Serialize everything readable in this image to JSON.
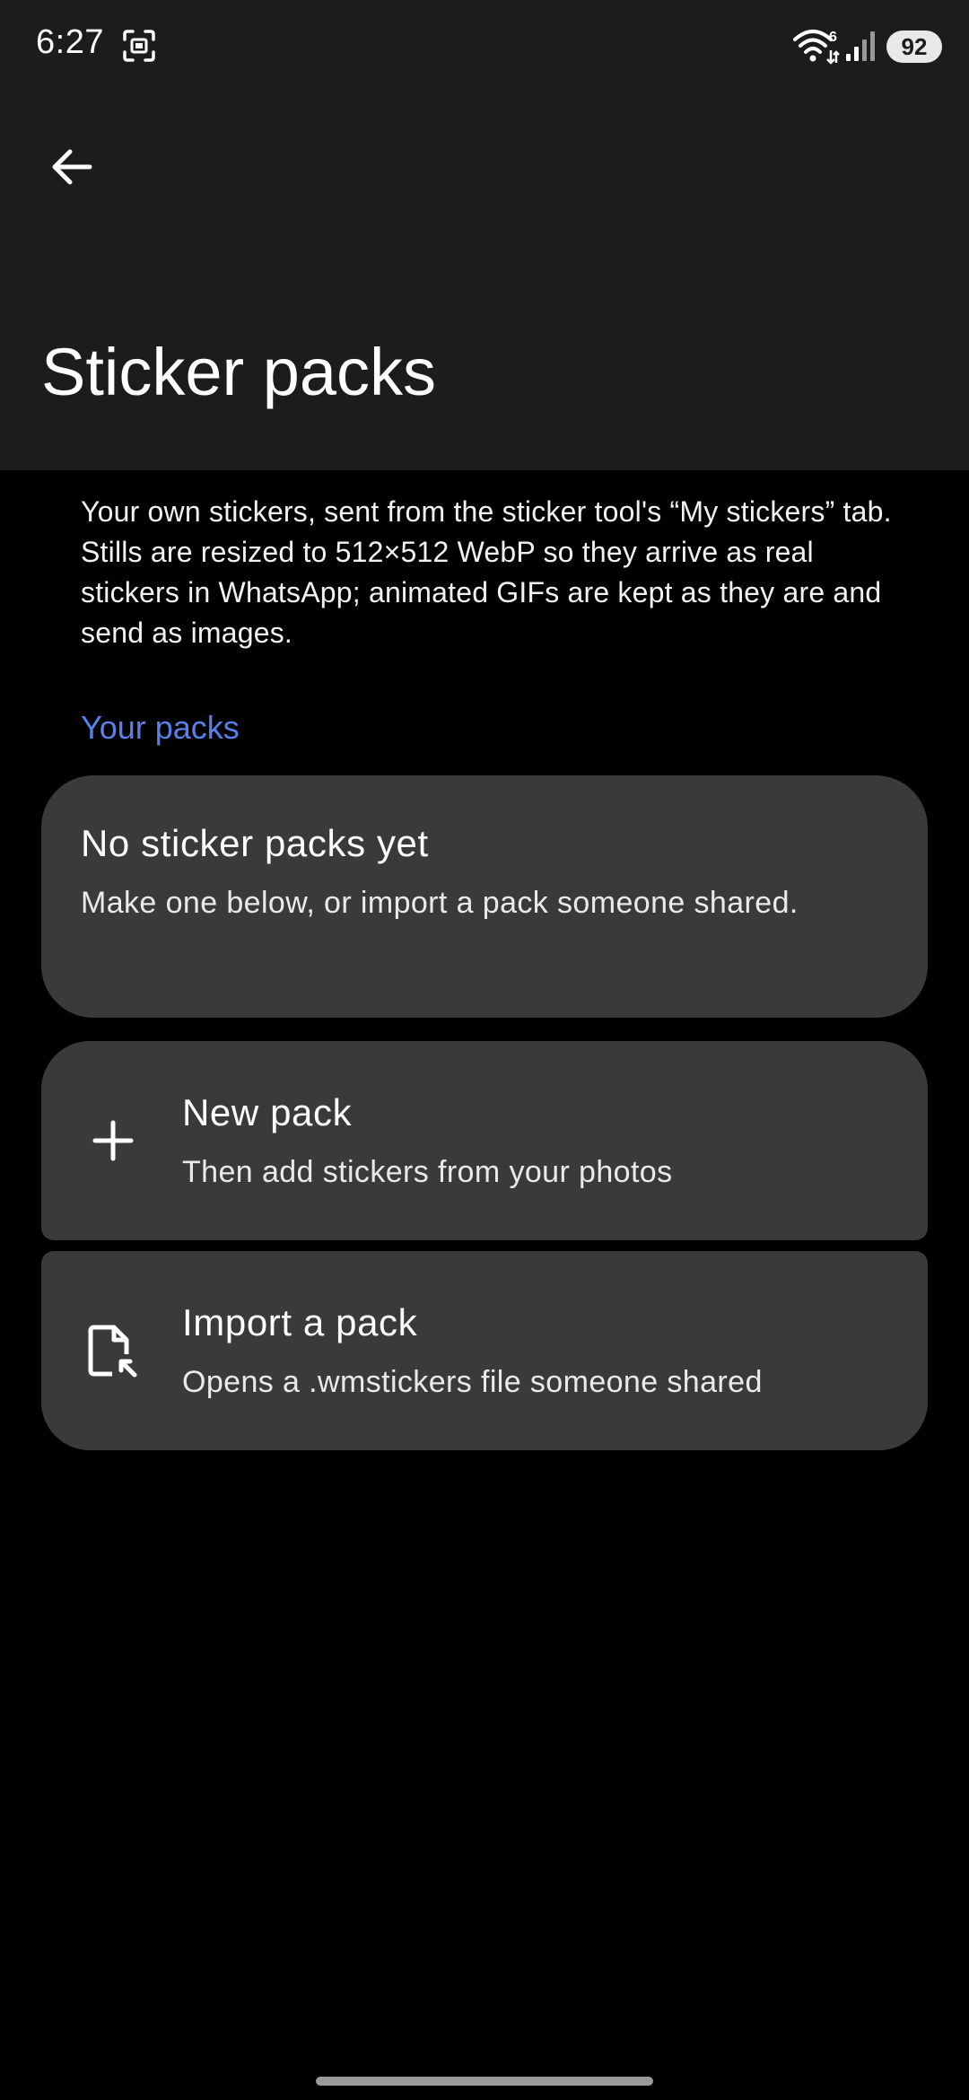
{
  "status_bar": {
    "time": "6:27",
    "wifi_badge": "6",
    "battery_level": "92",
    "icons": [
      "screenshot-icon",
      "wifi-icon",
      "signal-icon",
      "battery-icon"
    ]
  },
  "app_bar": {
    "back_icon": "arrow-left-icon",
    "title": "Sticker packs"
  },
  "main": {
    "description": "Your own stickers, sent from the sticker tool's “My stickers” tab. Stills are resized to 512×512 WebP so they arrive as real stickers in WhatsApp; animated GIFs are kept as they are and send as images.",
    "section_header": "Your packs",
    "empty_state": {
      "title": "No sticker packs yet",
      "subtitle": "Make one below, or import a pack someone shared."
    },
    "actions": [
      {
        "icon": "plus-icon",
        "title": "New pack",
        "subtitle": "Then add stickers from your photos"
      },
      {
        "icon": "file-import-icon",
        "title": "Import a pack",
        "subtitle": "Opens a .wmstickers file someone shared"
      }
    ]
  },
  "colors": {
    "background": "#000000",
    "app_bar": "#1c1c1e",
    "card": "#3a3a3c",
    "accent": "#5b7fe8"
  }
}
